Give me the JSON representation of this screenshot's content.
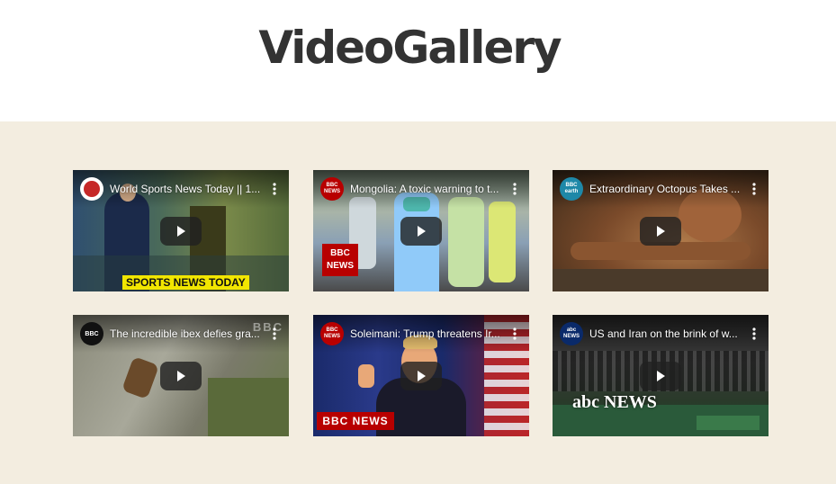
{
  "page": {
    "title": "VideoGallery"
  },
  "colors": {
    "header_bg": "#ffffff",
    "gallery_bg": "#f3ede0",
    "title_color": "#333333",
    "bbc_red": "#b80000"
  },
  "videos": [
    {
      "title": "World Sports News Today || 1...",
      "overlay_text": "SPORTS NEWS TODAY",
      "channel_icon": "sports-news-logo-icon"
    },
    {
      "title": "Mongolia: A toxic warning to t...",
      "overlay_text": "BBC NEWS",
      "channel_icon": "bbc-news-logo-icon"
    },
    {
      "title": "Extraordinary Octopus Takes ...",
      "overlay_text": "",
      "channel_icon": "bbc-earth-logo-icon"
    },
    {
      "title": "The incredible ibex defies gra...",
      "overlay_text": "BBC",
      "channel_icon": "bbc-logo-icon"
    },
    {
      "title": "Soleimani: Trump threatens Ir...",
      "overlay_text": "BBC NEWS",
      "channel_icon": "bbc-news-logo-icon"
    },
    {
      "title": "US and Iran on the brink of w...",
      "overlay_text": "abc NEWS",
      "channel_icon": "abc-news-logo-icon"
    }
  ]
}
